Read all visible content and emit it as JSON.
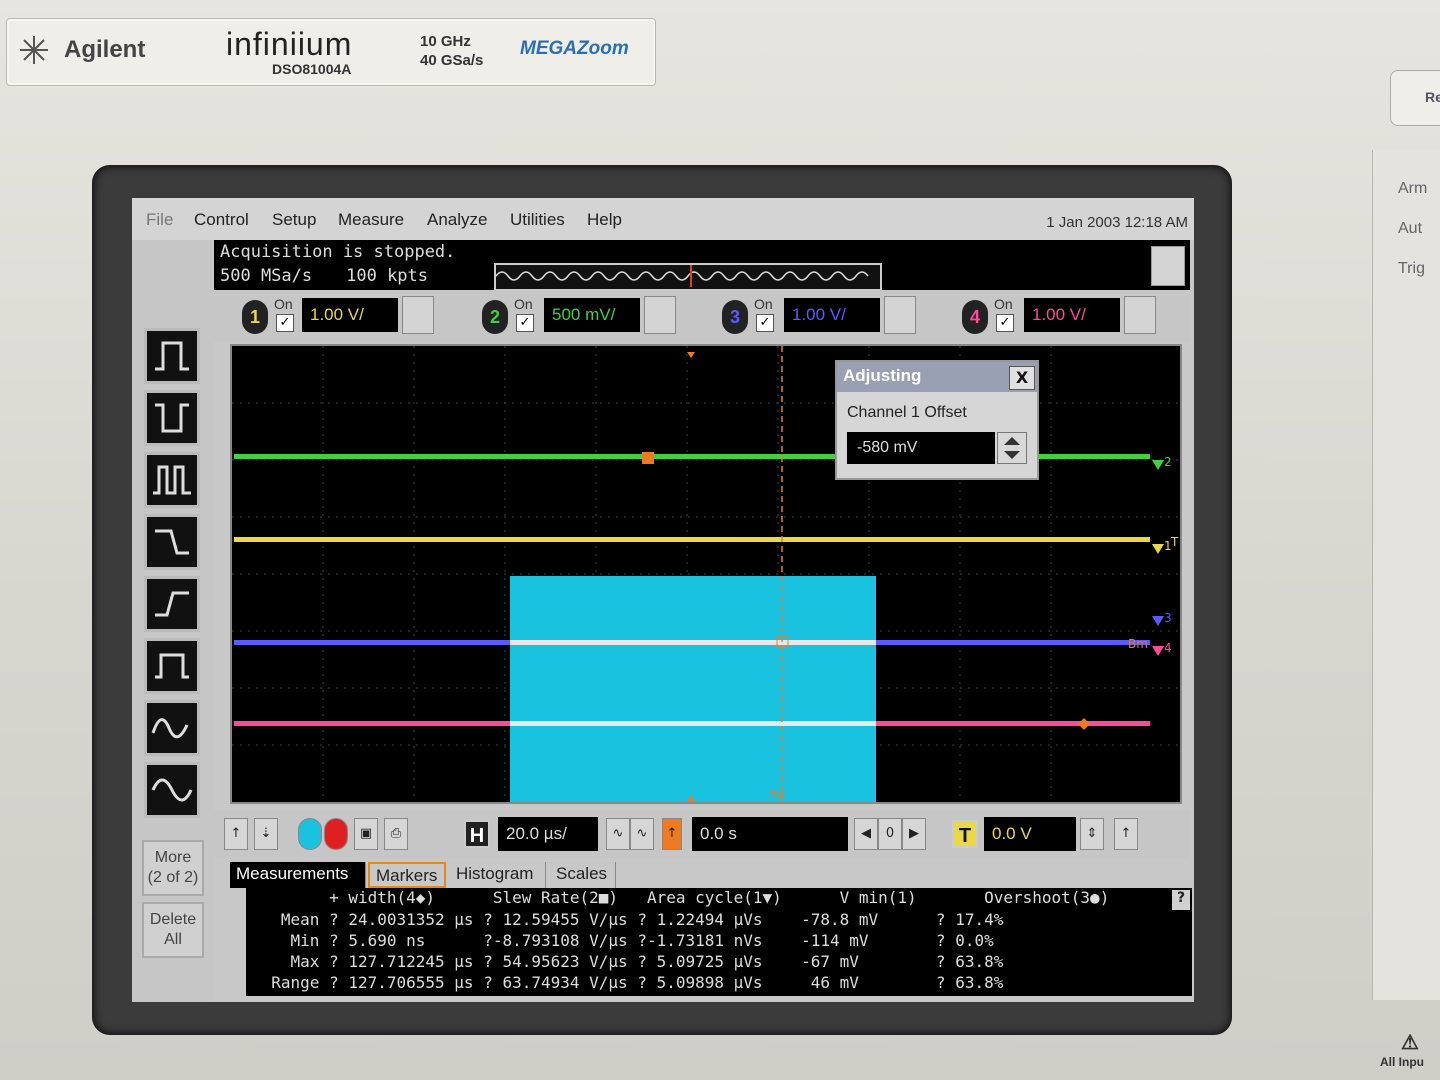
{
  "brand": {
    "company": "Agilent",
    "product": "infiniium",
    "model": "DSO81004A",
    "bandwidth": "10 GHz",
    "samplerate": "40 GSa/s",
    "feature_logo": "MEGAZoom"
  },
  "side_panel": {
    "button": "Re",
    "labels": [
      "Arm",
      "Aut",
      "Trig"
    ],
    "warning": "All Inpu"
  },
  "menu": {
    "items": [
      "File",
      "Control",
      "Setup",
      "Measure",
      "Analyze",
      "Utilities",
      "Help"
    ],
    "datetime": "1 Jan 2003 12:18 AM"
  },
  "status": {
    "line1": "Acquisition is stopped.",
    "rate": "500 MSa/s",
    "points": "100 kpts"
  },
  "channels": [
    {
      "num": "1",
      "on_label": "On",
      "checked": true,
      "scale": "1.00 V/",
      "color": "#e8d84a"
    },
    {
      "num": "2",
      "on_label": "On",
      "checked": true,
      "scale": "500 mV/",
      "color": "#3fd13f"
    },
    {
      "num": "3",
      "on_label": "On",
      "checked": true,
      "scale": "1.00 V/",
      "color": "#5a5aff"
    },
    {
      "num": "4",
      "on_label": "On",
      "checked": true,
      "scale": "1.00 V/",
      "color": "#ff4a9a"
    }
  ],
  "dialog": {
    "title": "Adjusting",
    "close": "X",
    "label": "Channel 1 Offset",
    "value": "-580 mV"
  },
  "waveform_labels": {
    "ch2": "2",
    "ch1": "1",
    "trig": "T",
    "ch3": "3",
    "ch4": "4",
    "bx": "Bx",
    "bm": "Bm"
  },
  "horizontal": {
    "h_icon": "H",
    "timebase": "20.0 µs/",
    "position": "0.0 s",
    "zero": "0",
    "t_icon": "T",
    "trigger_level": "0.0 V"
  },
  "side_buttons": {
    "more_line1": "More",
    "more_line2": "(2 of 2)",
    "delete_line1": "Delete",
    "delete_line2": "All"
  },
  "tabs": [
    "Measurements",
    "Markers",
    "Histogram",
    "Scales"
  ],
  "measurements": {
    "header": "        + width(4◆)      Slew Rate(2■)   Area cycle(1▼)      V min(1)       Overshoot(3●)",
    "rows": [
      "   Mean ? 24.0031352 µs ? 12.59455 V/µs ? 1.22494 µVs    -78.8 mV      ? 17.4%",
      "    Min ? 5.690 ns      ?-8.793108 V/µs ?-1.73181 nVs    -114 mV       ? 0.0%",
      "    Max ? 127.712245 µs ? 54.95623 V/µs ? 5.09725 µVs    -67 mV        ? 63.8%",
      "  Range ? 127.706555 µs ? 63.74934 V/µs ? 5.09898 µVs     46 mV        ? 63.8%"
    ],
    "help": "?"
  },
  "colors": {
    "ch1": "#e8d84a",
    "ch2": "#3fd13f",
    "ch3": "#5a5aff",
    "ch4": "#ff4a9a",
    "burst": "#19c3e0",
    "marker": "#f07a20"
  }
}
